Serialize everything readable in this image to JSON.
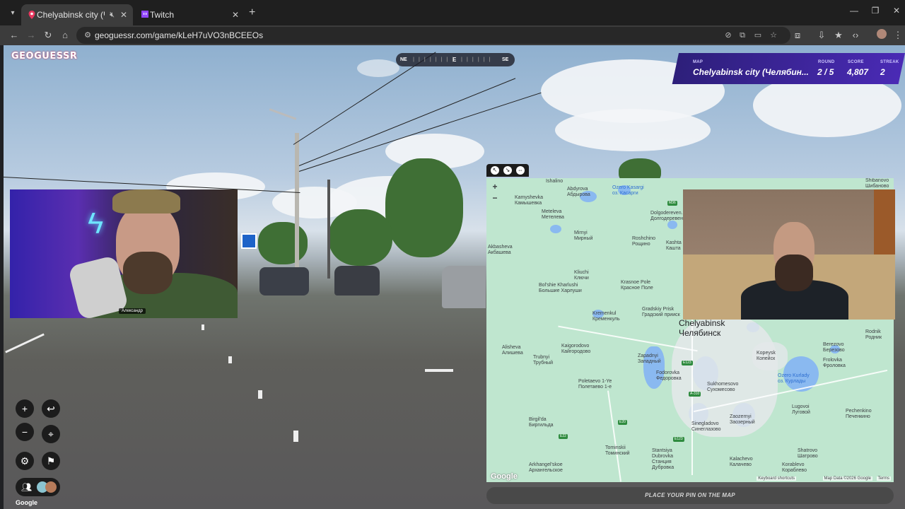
{
  "browser": {
    "tabs": [
      {
        "title": "Chelyabinsk city (Челябинс",
        "active": true,
        "favicon": "map-pin-icon"
      },
      {
        "title": "Twitch",
        "active": false,
        "favicon": "twitch-icon"
      }
    ],
    "url": "geoguessr.com/game/kLeH7uVO3nBCEEOs"
  },
  "game": {
    "logo": "GEOGUESSR",
    "compass": {
      "left": "NE",
      "center": "E",
      "right": "SE"
    },
    "status": {
      "map_label": "MAP",
      "map_value": "Chelyabinsk city (Челябин...",
      "round_label": "ROUND",
      "round_value": "2 / 5",
      "score_label": "SCORE",
      "score_value": "4,807",
      "streak_label": "STREAK",
      "streak_value": "2"
    },
    "place_pin_label": "PLACE YOUR PIN ON THE MAP",
    "streetview_brand": "Google"
  },
  "webcam": {
    "name": "Александр"
  },
  "map": {
    "city_en": "Chelyabinsk",
    "city_ru": "Челябинск",
    "places": [
      {
        "en": "Ishalino",
        "ru": ""
      },
      {
        "en": "Abdyrova",
        "ru": "Абдырова"
      },
      {
        "en": "Kamyshevka",
        "ru": "Камышевка"
      },
      {
        "en": "Meteleva",
        "ru": "Метелева"
      },
      {
        "en": "Mirnyi",
        "ru": "Мирный"
      },
      {
        "en": "Akbasheva",
        "ru": "Акбашева"
      },
      {
        "en": "Kliuchi",
        "ru": "Ключи"
      },
      {
        "en": "Bol'shie Kharlushi",
        "ru": "Большие Харлуши"
      },
      {
        "en": "Krasnoe Pole",
        "ru": "Красное Поле"
      },
      {
        "en": "Kremenkul",
        "ru": "Кременкуль"
      },
      {
        "en": "Gradskiy Prisk",
        "ru": "Градский прииск"
      },
      {
        "en": "Roshchino",
        "ru": "Рощино"
      },
      {
        "en": "Dolgodereven...",
        "ru": "Долгодеревен..."
      },
      {
        "en": "Kashta",
        "ru": "Кашта"
      },
      {
        "en": "Alisheva",
        "ru": "Алишева"
      },
      {
        "en": "Kaigorodovo",
        "ru": "Кайгородово"
      },
      {
        "en": "Trubnyi",
        "ru": "Трубный"
      },
      {
        "en": "Zapadnyi",
        "ru": "Западный"
      },
      {
        "en": "Fodorovka",
        "ru": "Федоровка"
      },
      {
        "en": "Poletaevo 1-Ye",
        "ru": "Полетаево 1-е"
      },
      {
        "en": "Birgil'da",
        "ru": "Биргильда"
      },
      {
        "en": "Tominskii",
        "ru": "Томинский"
      },
      {
        "en": "Arkhangel'skoe",
        "ru": "Архангельское"
      },
      {
        "en": "Stantsiya Dubrovka",
        "ru": "Станция Дубровка"
      },
      {
        "en": "Sinegladovo",
        "ru": "Синеглазово"
      },
      {
        "en": "Sukhomesovo",
        "ru": "Сухомесово"
      },
      {
        "en": "Zaozernyi",
        "ru": "Заозерный"
      },
      {
        "en": "Kalachevo",
        "ru": "Калачево"
      },
      {
        "en": "Shatrovo",
        "ru": "Шатрово"
      },
      {
        "en": "Korablevo",
        "ru": "Кораблево"
      },
      {
        "en": "Kopeysk",
        "ru": "Копейск"
      },
      {
        "en": "Berezovo",
        "ru": "Березово"
      },
      {
        "en": "Frolovka",
        "ru": "Фроловка"
      },
      {
        "en": "Lugovoi",
        "ru": "Луговой"
      },
      {
        "en": "Pechenkino",
        "ru": "Печенкино"
      },
      {
        "en": "Rodnik",
        "ru": "Родник"
      },
      {
        "en": "Shibanovo",
        "ru": "Шибаново"
      }
    ],
    "water": [
      {
        "en": "Ozero Kasargi",
        "ru": "оз. Касарги"
      },
      {
        "en": "Ozero Kurlady",
        "ru": "оз. Курлады"
      }
    ],
    "shields": [
      "M36",
      "E123",
      "A-310",
      "E20",
      "E22",
      "E123"
    ],
    "footer": {
      "shortcuts": "Keyboard shortcuts",
      "mapdata": "Map Data ©2026 Google",
      "terms": "Terms",
      "logo": "Google"
    },
    "zoom_in": "+",
    "zoom_out": "−"
  }
}
